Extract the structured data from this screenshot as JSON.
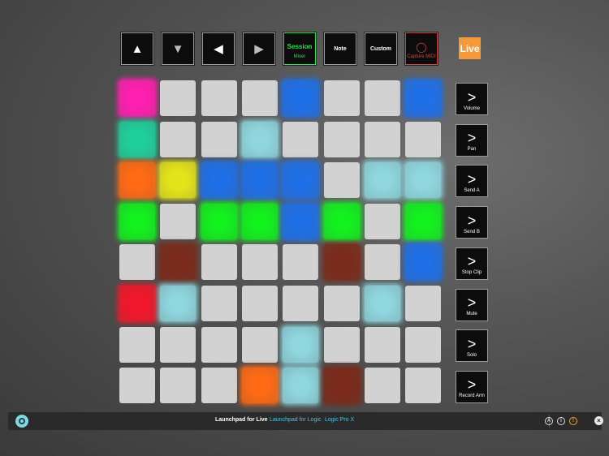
{
  "top_buttons": [
    {
      "icon": "up-arrow-icon",
      "glyph": "▲"
    },
    {
      "icon": "down-arrow-icon",
      "glyph": "▼"
    },
    {
      "icon": "left-arrow-icon",
      "glyph": "◀"
    },
    {
      "icon": "right-arrow-icon",
      "glyph": "▶"
    }
  ],
  "modes": {
    "session": "Session",
    "session_sub": "Mixer",
    "note": "Note",
    "custom": "Custom",
    "capture_glyph": "◯",
    "capture": "Capture MIDI"
  },
  "logo": "Live",
  "colors": {
    "W": "#d2d2d2",
    "M": "#ff1fb0",
    "T": "#1fcf9a",
    "O": "#ff6a14",
    "Y": "#e4e41a",
    "B": "#1f6fe6",
    "C": "#8fd6de",
    "G": "#12f01e",
    "R": "#f0182a",
    "D": "#7a2a1a"
  },
  "pad_rows": [
    [
      "M",
      "W",
      "W",
      "W",
      "B",
      "W",
      "W",
      "B"
    ],
    [
      "T",
      "W",
      "W",
      "C",
      "W",
      "W",
      "W",
      "W"
    ],
    [
      "O",
      "Y",
      "B",
      "B",
      "B",
      "W",
      "C",
      "C"
    ],
    [
      "G",
      "W",
      "G",
      "G",
      "B",
      "G",
      "W",
      "G"
    ],
    [
      "W",
      "D",
      "W",
      "W",
      "W",
      "D",
      "W",
      "B"
    ],
    [
      "R",
      "C",
      "W",
      "W",
      "W",
      "W",
      "C",
      "W"
    ],
    [
      "W",
      "W",
      "W",
      "W",
      "C",
      "W",
      "W",
      "W"
    ],
    [
      "W",
      "W",
      "W",
      "O",
      "C",
      "D",
      "W",
      "W"
    ]
  ],
  "scene_buttons": [
    {
      "chevron": ">",
      "label": "Volume"
    },
    {
      "chevron": ">",
      "label": "Pan"
    },
    {
      "chevron": ">",
      "label": "Send A"
    },
    {
      "chevron": ">",
      "label": "Send B"
    },
    {
      "chevron": ">",
      "label": "Stop Clip"
    },
    {
      "chevron": ">",
      "label": "Mute"
    },
    {
      "chevron": ">",
      "label": "Solo"
    },
    {
      "chevron": ">",
      "label": "Record Arm"
    }
  ],
  "bottom_bar": {
    "title": "Launchpad for Live",
    "link1": "Launchpad for Logic",
    "link2": "Logic Pro X",
    "icon_a": "A",
    "icon_i": "i",
    "icon_warn": "!",
    "close": "×"
  }
}
